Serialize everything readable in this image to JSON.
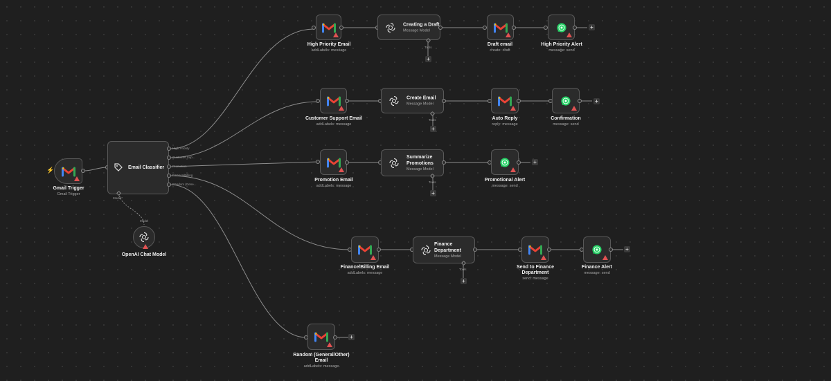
{
  "colors": {
    "background": "#1f1f1f",
    "node_bg": "#2b2b2b",
    "node_border": "#595959",
    "warning": "#e05252",
    "whatsapp": "#25d366",
    "trigger_bolt": "#e0523a"
  },
  "trigger": {
    "title": "Gmail Trigger",
    "subtitle": "Gmail Trigger",
    "icon": "gmail-icon"
  },
  "classifier": {
    "title": "Email Classifier",
    "icon": "classifier-tag-icon",
    "outputs": [
      "High Priority",
      "Customer Sup...",
      "Promotion",
      "Finance/Billing",
      "Random (Gene..."
    ],
    "model_label": "Model*"
  },
  "chat_model": {
    "title": "OpenAI Chat Model",
    "port_label": "Model",
    "icon": "openai-icon"
  },
  "tools_label": "Tools",
  "rows": {
    "high": {
      "gmail": {
        "title": "High Priority Email",
        "subtitle": "addLabels: message"
      },
      "agent": {
        "title": "Creating a Draft",
        "subtitle": "Message Model"
      },
      "action": {
        "title": "Draft email",
        "subtitle": "create: draft"
      },
      "alert": {
        "title": "High Priority Alert",
        "subtitle": "message: send"
      }
    },
    "support": {
      "gmail": {
        "title": "Customer Support Email",
        "subtitle": "addLabels: message"
      },
      "agent": {
        "title": "Create Email",
        "subtitle": "Message Model"
      },
      "action": {
        "title": "Auto Reply",
        "subtitle": "reply: message"
      },
      "alert": {
        "title": "Confirmation",
        "subtitle": "message: send"
      }
    },
    "promo": {
      "gmail": {
        "title": "Promotion Email",
        "subtitle": "addLabels: message"
      },
      "agent": {
        "title": "Summarize Promotions",
        "subtitle": "Message Model"
      },
      "alert": {
        "title": "Promotional Alert",
        "subtitle": "message: send"
      }
    },
    "finance": {
      "gmail": {
        "title": "Finance/Billing Email",
        "subtitle": "addLabels: message"
      },
      "agent": {
        "title": "Finance Department",
        "subtitle": "Message Model"
      },
      "action": {
        "title": "Send to Finance Department",
        "subtitle": "send: message"
      },
      "alert": {
        "title": "Finance Alert",
        "subtitle": "message: send"
      }
    },
    "random": {
      "gmail": {
        "title": "Random (General/Other) Email",
        "subtitle": "addLabels: message"
      }
    }
  }
}
